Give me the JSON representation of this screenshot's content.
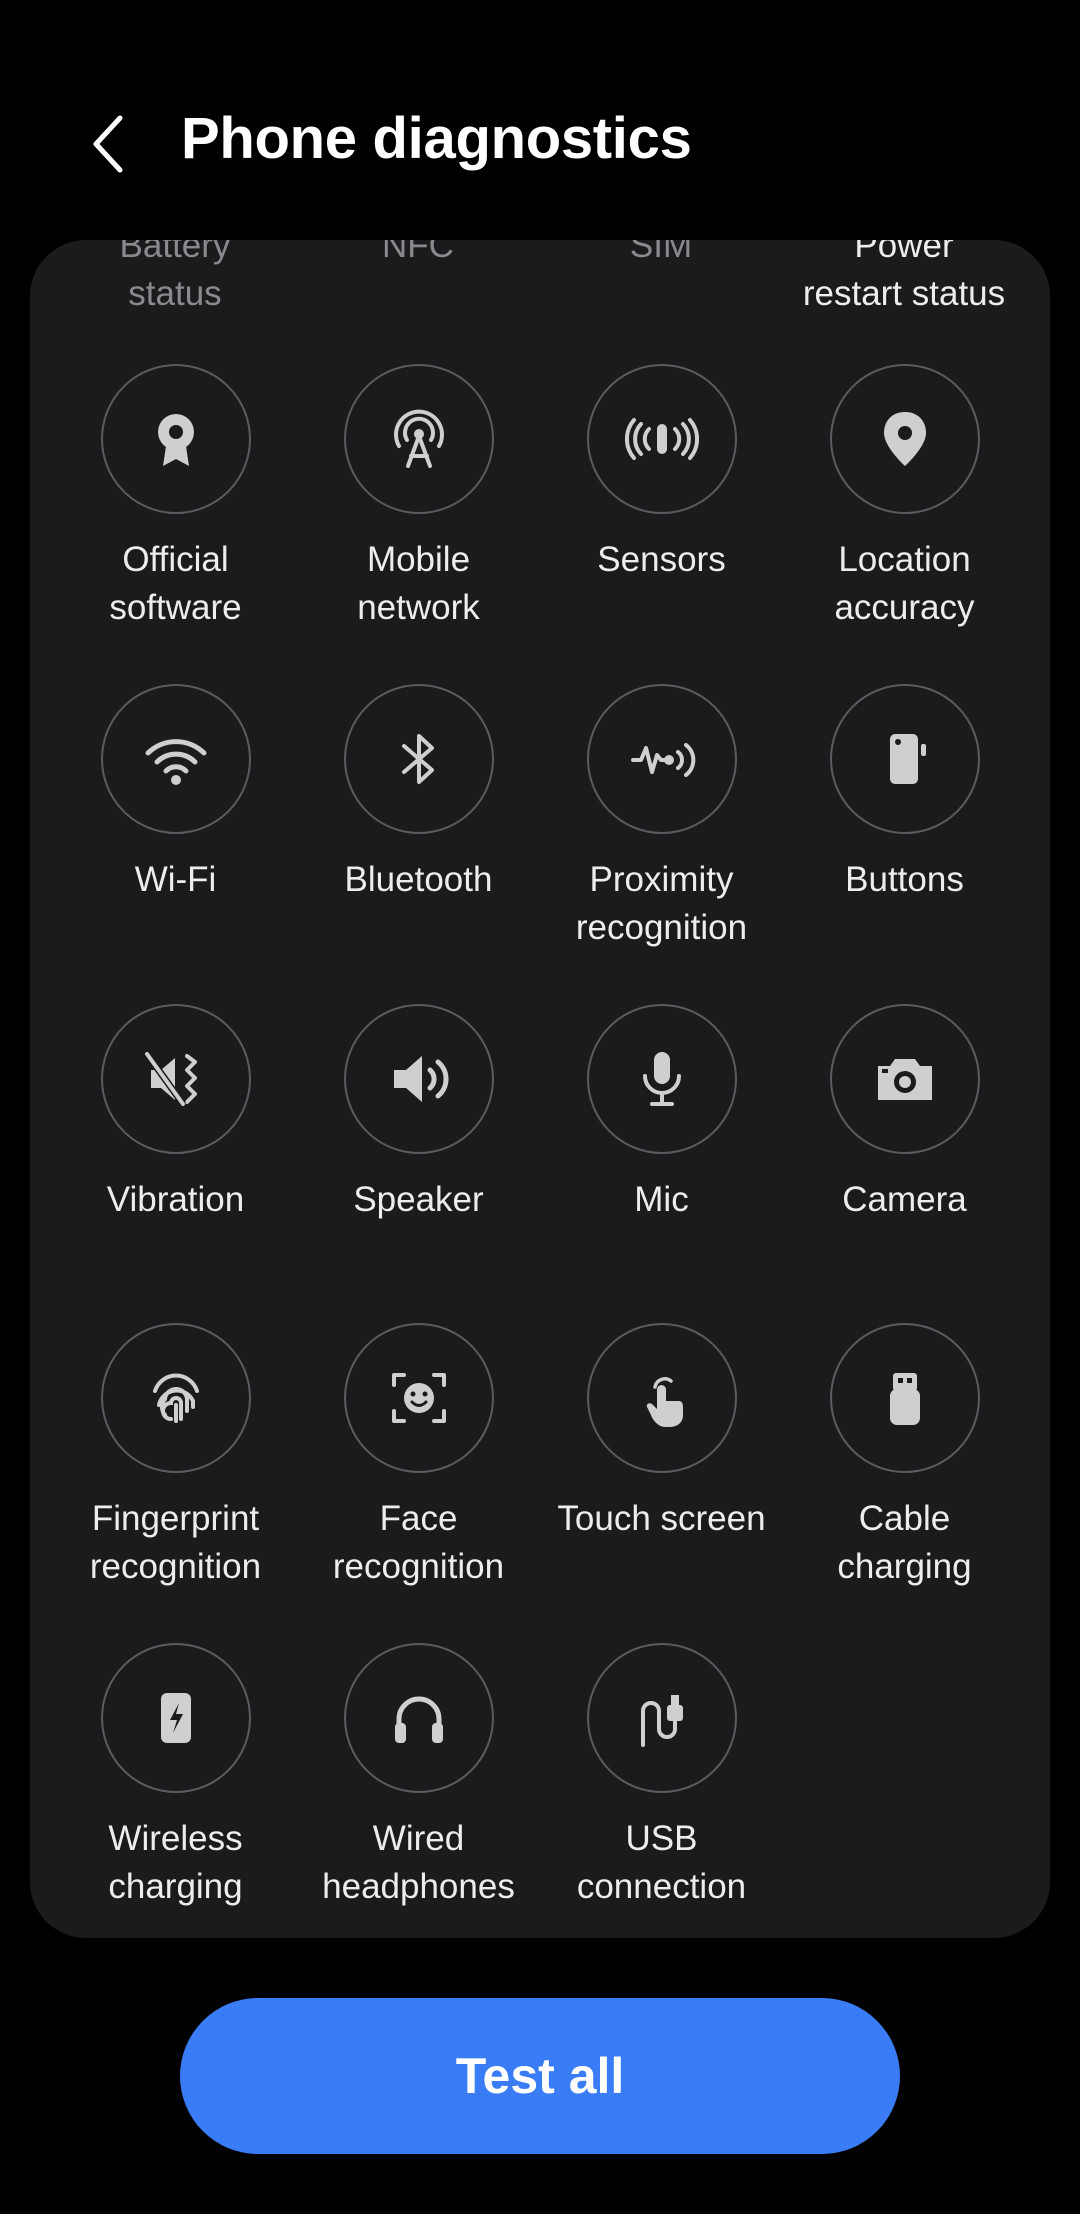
{
  "header": {
    "title": "Phone diagnostics"
  },
  "partial_row": [
    {
      "label": "Battery\nstatus",
      "color": "#8a8a8e"
    },
    {
      "label": "NFC",
      "color": "#8a8a8e"
    },
    {
      "label": "SIM",
      "color": "#8a8a8e"
    },
    {
      "label": "Power\nrestart status",
      "color": "#ededed"
    }
  ],
  "tests": [
    {
      "label": "Official\nsoftware",
      "icon": "badge-icon"
    },
    {
      "label": "Mobile\nnetwork",
      "icon": "antenna-icon"
    },
    {
      "label": "Sensors",
      "icon": "sensor-waves-icon"
    },
    {
      "label": "Location\naccuracy",
      "icon": "location-pin-icon"
    },
    {
      "label": "Wi-Fi",
      "icon": "wifi-icon"
    },
    {
      "label": "Bluetooth",
      "icon": "bluetooth-icon"
    },
    {
      "label": "Proximity\nrecognition",
      "icon": "proximity-icon"
    },
    {
      "label": "Buttons",
      "icon": "phone-buttons-icon"
    },
    {
      "label": "Vibration",
      "icon": "vibration-icon"
    },
    {
      "label": "Speaker",
      "icon": "speaker-icon"
    },
    {
      "label": "Mic",
      "icon": "mic-icon"
    },
    {
      "label": "Camera",
      "icon": "camera-icon"
    },
    {
      "label": "Fingerprint\nrecognition",
      "icon": "fingerprint-icon"
    },
    {
      "label": "Face\nrecognition",
      "icon": "face-icon"
    },
    {
      "label": "Touch screen",
      "icon": "touch-icon"
    },
    {
      "label": "Cable\ncharging",
      "icon": "cable-plug-icon"
    },
    {
      "label": "Wireless\ncharging",
      "icon": "wireless-charging-icon"
    },
    {
      "label": "Wired\nheadphones",
      "icon": "headphones-icon"
    },
    {
      "label": "USB\nconnection",
      "icon": "usb-cable-icon"
    }
  ],
  "footer": {
    "test_all_label": "Test all"
  },
  "colors": {
    "accent": "#3a7cf6",
    "card": "#1b1b1d",
    "background": "#000000"
  }
}
